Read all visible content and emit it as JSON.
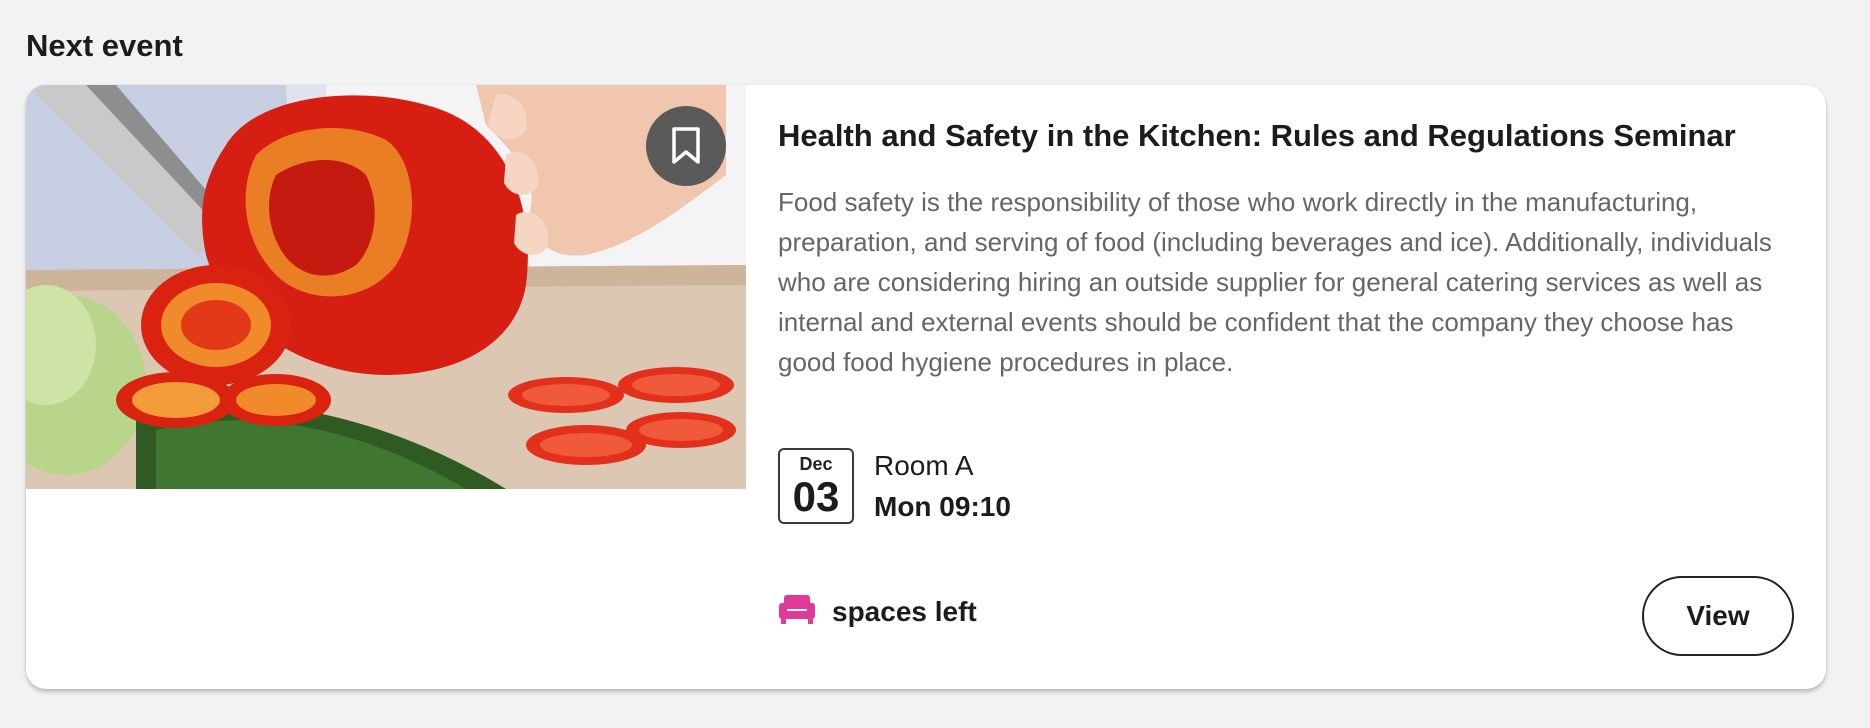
{
  "section": {
    "title": "Next event"
  },
  "event": {
    "title": "Health and Safety in the Kitchen: Rules and Regulations Seminar",
    "description": "Food safety is the responsibility of those who work directly in the manufacturing, preparation, and serving of food (including beverages and ice). Additionally, individuals who are considering hiring an outside supplier for general catering services as well as internal and external events should be confident that the company they choose has good food hygiene procedures in place.",
    "date": {
      "month": "Dec",
      "day": "03"
    },
    "location": "Room A",
    "datetime": "Mon 09:10",
    "spaces_label": "spaces left",
    "view_label": "View"
  },
  "icons": {
    "bookmark": "bookmark-icon",
    "spaces": "armchair-icon"
  },
  "colors": {
    "accent": "#e1399a",
    "bookmark_bg": "#5a5a5a",
    "page_bg": "#f2f2f2"
  }
}
